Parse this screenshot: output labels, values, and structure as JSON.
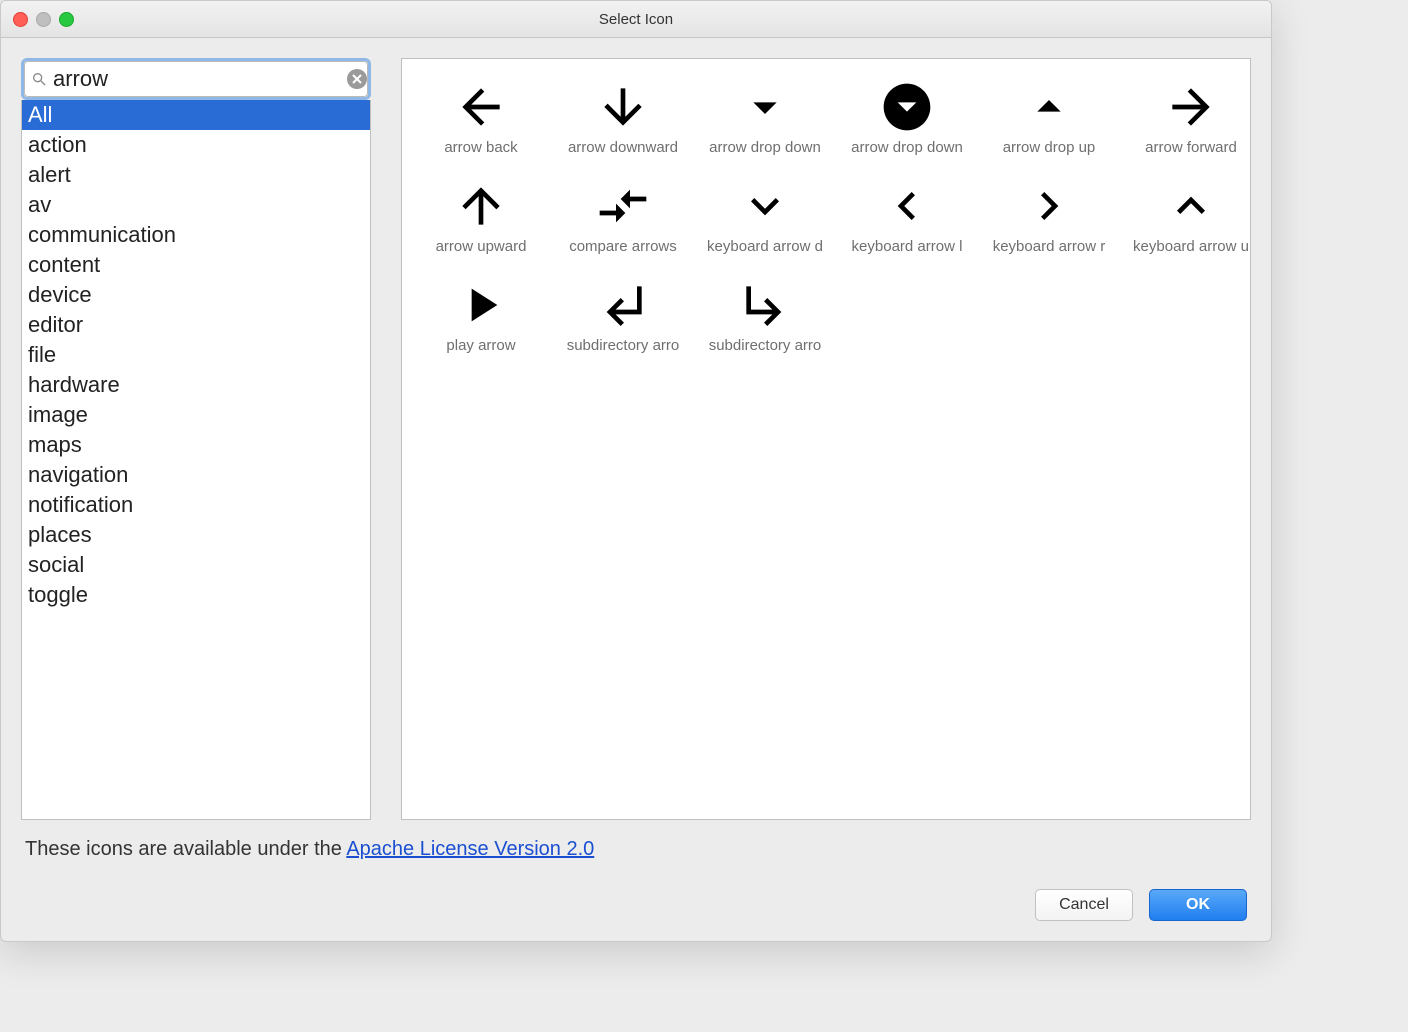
{
  "window": {
    "title": "Select Icon"
  },
  "search": {
    "value": "arrow"
  },
  "categories": {
    "selected_index": 0,
    "items": [
      "All",
      "action",
      "alert",
      "av",
      "communication",
      "content",
      "device",
      "editor",
      "file",
      "hardware",
      "image",
      "maps",
      "navigation",
      "notification",
      "places",
      "social",
      "toggle"
    ]
  },
  "icons": [
    {
      "id": "arrow-back",
      "label": "arrow back"
    },
    {
      "id": "arrow-downward",
      "label": "arrow downward"
    },
    {
      "id": "arrow-drop-down",
      "label": "arrow drop down"
    },
    {
      "id": "arrow-drop-down-circle",
      "label": "arrow drop down"
    },
    {
      "id": "arrow-drop-up",
      "label": "arrow drop up"
    },
    {
      "id": "arrow-forward",
      "label": "arrow forward"
    },
    {
      "id": "arrow-upward",
      "label": "arrow upward"
    },
    {
      "id": "compare-arrows",
      "label": "compare arrows"
    },
    {
      "id": "keyboard-arrow-down",
      "label": "keyboard arrow d"
    },
    {
      "id": "keyboard-arrow-left",
      "label": "keyboard arrow l"
    },
    {
      "id": "keyboard-arrow-right",
      "label": "keyboard arrow r"
    },
    {
      "id": "keyboard-arrow-up",
      "label": "keyboard arrow u"
    },
    {
      "id": "play-arrow",
      "label": "play arrow"
    },
    {
      "id": "subdirectory-arrow-left",
      "label": "subdirectory arro"
    },
    {
      "id": "subdirectory-arrow-right",
      "label": "subdirectory arro"
    }
  ],
  "license": {
    "prefix": "These icons are available under the ",
    "link_text": "Apache License Version 2.0"
  },
  "buttons": {
    "cancel": "Cancel",
    "ok": "OK"
  }
}
